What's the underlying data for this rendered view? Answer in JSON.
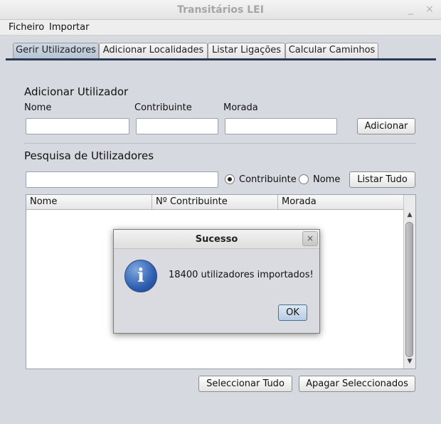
{
  "window": {
    "title": "Transitários LEI",
    "minimize_label": "_",
    "close_label": "×"
  },
  "menu": {
    "items": [
      "Ficheiro",
      "Importar"
    ]
  },
  "tabs": [
    "Gerir Utilizadores",
    "Adicionar Localidades",
    "Listar Ligações",
    "Calcular Caminhos"
  ],
  "add_user": {
    "heading": "Adicionar Utilizador",
    "labels": {
      "nome": "Nome",
      "contribuinte": "Contribuinte",
      "morada": "Morada"
    },
    "values": {
      "nome": "",
      "contribuinte": "",
      "morada": ""
    },
    "button": "Adicionar"
  },
  "search": {
    "heading": "Pesquisa de Utilizadores",
    "query": "",
    "radio_contribuinte": "Contribuinte",
    "radio_nome": "Nome",
    "selected": "Contribuinte",
    "list_all_button": "Listar Tudo"
  },
  "table": {
    "columns": [
      "Nome",
      "Nº Contribuinte",
      "Morada"
    ],
    "rows": [],
    "scroll_up": "▲",
    "scroll_down": "▼"
  },
  "actions": {
    "select_all": "Seleccionar Tudo",
    "delete_selected": "Apagar Seleccionados"
  },
  "dialog": {
    "title": "Sucesso",
    "message": "18400 utilizadores importados!",
    "icon": "information-icon",
    "icon_glyph": "i",
    "close_label": "×",
    "ok": "OK"
  },
  "colors": {
    "accent": "#2a3a55",
    "info_icon": "#2f5fb0"
  }
}
